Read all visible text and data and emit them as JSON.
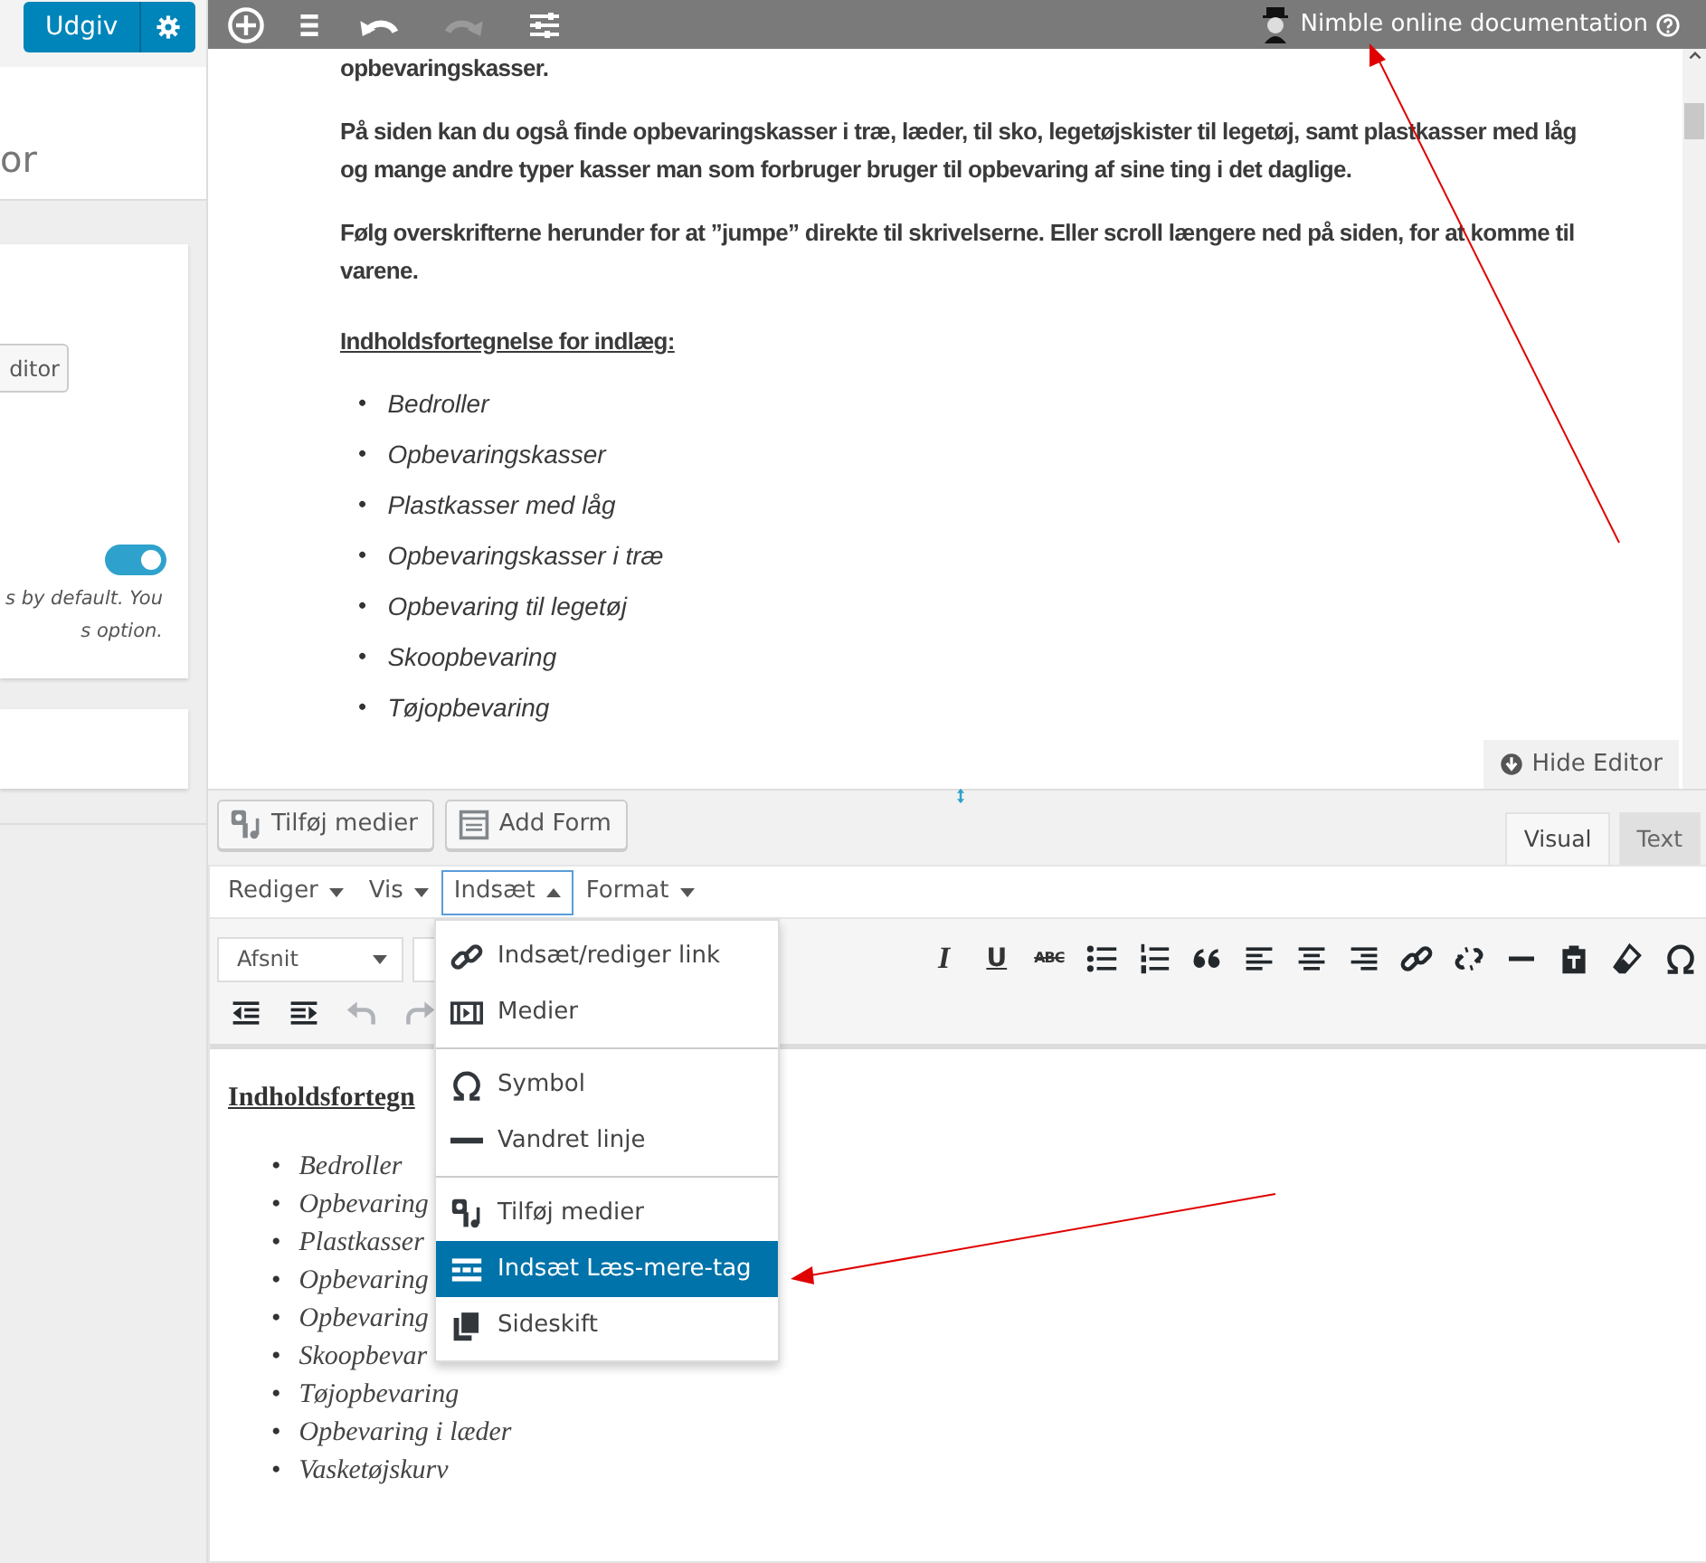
{
  "sidebar": {
    "publish_button": "Udgiv",
    "panel_title": "or",
    "editor_button": "ditor",
    "toggle": {
      "on": true
    },
    "note_lines": [
      "s by default. You",
      "s option."
    ]
  },
  "top_bar": {
    "help_link": "Nimble online documentation"
  },
  "preview": {
    "paragraphs": [
      "opbevaringskasser.",
      "På siden kan du også finde opbevaringskasser i træ, læder, til sko, legetøjskister til legetøj, samt plastkasser med låg og mange andre typer kasser man som forbruger bruger til opbevaring af sine ting i det daglige.",
      "Følg overskrifterne herunder for at ”jumpe” direkte til skrivelserne. Eller scroll længere ned på siden, for at komme til varene."
    ],
    "heading": "Indholdsfortegnelse for indlæg:",
    "marker": "•",
    "links": [
      "Bedroller",
      "Opbevaringskasser",
      "Plastkasser med låg",
      "Opbevaringskasser i træ",
      "Opbevaring til legetøj",
      "Skoopbevaring",
      "Tøjopbevaring"
    ],
    "hide_button": "Hide Editor"
  },
  "media_buttons": [
    "Tilføj medier",
    "Add Form"
  ],
  "tabs": [
    {
      "label": "Visual",
      "selected": true
    },
    {
      "label": "Text",
      "selected": false
    }
  ],
  "menubar": [
    {
      "label": "Rediger",
      "expanded": false
    },
    {
      "label": "Vis",
      "expanded": false
    },
    {
      "label": "Indsæt",
      "expanded": true
    },
    {
      "label": "Format",
      "expanded": false
    }
  ],
  "toolbar": {
    "format_select": "Afsnit",
    "row_1": [
      {
        "kind": "italic",
        "label": "I"
      },
      {
        "kind": "underline",
        "label": "U"
      },
      {
        "kind": "strike",
        "label": "ABC"
      },
      {
        "kind": "icon"
      },
      {
        "kind": "icon"
      },
      {
        "kind": "icon"
      },
      {
        "kind": "icon"
      },
      {
        "kind": "icon"
      },
      {
        "kind": "icon"
      },
      {
        "kind": "icon"
      },
      {
        "kind": "icon"
      },
      {
        "kind": "icon"
      },
      {
        "kind": "icon"
      },
      {
        "kind": "icon"
      },
      {
        "kind": "icon"
      }
    ],
    "row_2": [
      {
        "disabled": false
      },
      {
        "disabled": false
      },
      {
        "disabled": true
      },
      {
        "disabled": true
      }
    ]
  },
  "insert_menu": [
    [
      {
        "label": "Indsæt/rediger link",
        "selected": false
      },
      {
        "label": "Medier",
        "selected": false
      }
    ],
    [
      {
        "label": "Symbol",
        "selected": false
      },
      {
        "label": "Vandret linje",
        "selected": false
      }
    ],
    [
      {
        "label": "Tilføj medier",
        "selected": false
      },
      {
        "label": "Indsæt Læs-mere-tag",
        "selected": true
      },
      {
        "label": "Sideskift",
        "selected": false
      }
    ]
  ],
  "editor_content": {
    "heading": "Indholdsfortegn",
    "marker": "•",
    "links": [
      "Bedroller",
      "Opbevaring",
      "Plastkasser",
      "Opbevaring",
      "Opbevaring",
      "Skoopbevar",
      "Tøjopbevaring",
      "Opbevaring i læder",
      "Vasketøjskurv"
    ]
  }
}
